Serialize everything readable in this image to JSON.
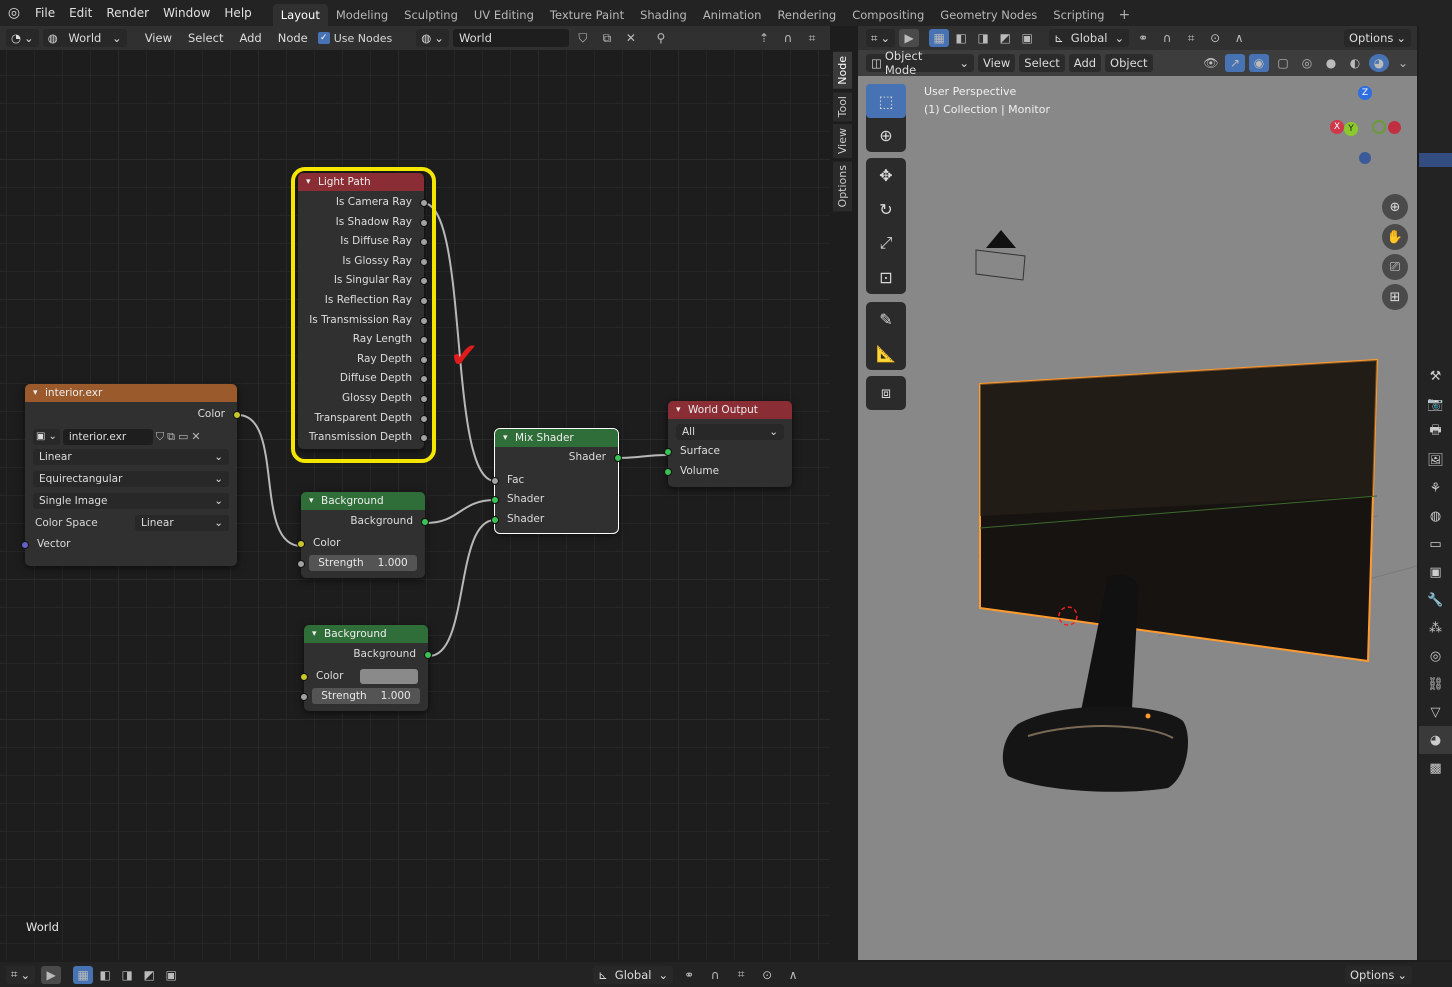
{
  "menu": {
    "items": [
      "File",
      "Edit",
      "Render",
      "Window",
      "Help"
    ]
  },
  "workspaces": {
    "tabs": [
      "Layout",
      "Modeling",
      "Sculpting",
      "UV Editing",
      "Texture Paint",
      "Shading",
      "Animation",
      "Rendering",
      "Compositing",
      "Geometry Nodes",
      "Scripting"
    ],
    "active": "Layout",
    "add": "+"
  },
  "node_editor": {
    "header": {
      "shader_type": "World",
      "menus": [
        "View",
        "Select",
        "Add",
        "Node"
      ],
      "use_nodes_label": "Use Nodes",
      "world_name": "World"
    },
    "side_tabs": [
      "Node",
      "Tool",
      "View",
      "Options"
    ],
    "footer_label": "World",
    "nodes": {
      "light_path": {
        "title": "Light Path",
        "outputs": [
          "Is Camera Ray",
          "Is Shadow Ray",
          "Is Diffuse Ray",
          "Is Glossy Ray",
          "Is Singular Ray",
          "Is Reflection Ray",
          "Is Transmission Ray",
          "Ray Length",
          "Ray Depth",
          "Diffuse Depth",
          "Glossy Depth",
          "Transparent Depth",
          "Transmission Depth"
        ]
      },
      "image": {
        "title": "interior.exr",
        "out_color": "Color",
        "image_name": "interior.exr",
        "interpolation": "Linear",
        "projection": "Equirectangular",
        "source": "Single Image",
        "color_space_label": "Color Space",
        "color_space": "Linear",
        "in_vector": "Vector"
      },
      "bg1": {
        "title": "Background",
        "out": "Background",
        "in_color": "Color",
        "strength_label": "Strength",
        "strength": "1.000"
      },
      "bg2": {
        "title": "Background",
        "out": "Background",
        "in_color": "Color",
        "strength_label": "Strength",
        "strength": "1.000",
        "color": "#8a8a8a"
      },
      "mix": {
        "title": "Mix Shader",
        "out": "Shader",
        "in_fac": "Fac",
        "in_shader1": "Shader",
        "in_shader2": "Shader"
      },
      "world_output": {
        "title": "World Output",
        "target": "All",
        "in_surface": "Surface",
        "in_volume": "Volume"
      }
    }
  },
  "viewport": {
    "header": {
      "transform": "Global",
      "options": "Options"
    },
    "mode": "Object Mode",
    "menus": [
      "View",
      "Select",
      "Add",
      "Object"
    ],
    "perspective": "User Perspective",
    "collection": "(1) Collection | Monitor",
    "axes": {
      "z": "Z",
      "y": "Y",
      "x": "X"
    }
  },
  "status": {
    "transform": "Global",
    "options": "Options"
  },
  "colors": {
    "highlight": "#f5e600",
    "check": "#e01b1b",
    "selection_outline": "#ff9a2e"
  }
}
